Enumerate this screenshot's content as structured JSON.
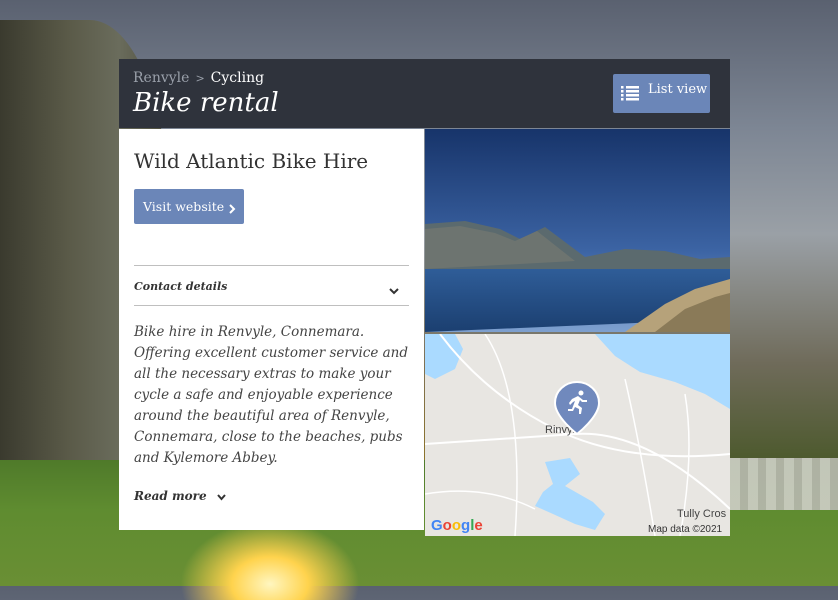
{
  "header": {
    "breadcrumb_parent": "Renvyle",
    "breadcrumb_sep": ">",
    "breadcrumb_current": "Cycling",
    "title": "Bike rental",
    "list_view_label": "List view"
  },
  "listing": {
    "name": "Wild Atlantic Bike Hire",
    "visit_label": "Visit website",
    "contact_label": "Contact details",
    "description": "Bike hire in Renvyle, Connemara. Offering excellent customer service and all the necessary extras to make your cycle a safe and enjoyable experience around the beautiful area of Renvyle, Connemara, close to the beaches, pubs and Kylemore Abbey.",
    "read_more_label": "Read more"
  },
  "map": {
    "town_label": "Rinvyle",
    "tully_label": "Tully Cros",
    "map_data": "Map data ©2021",
    "logo_text": "Google",
    "marker_icon": "running-person-icon"
  },
  "colors": {
    "header_bg": "#2f333c",
    "accent_button": "#6b86b8",
    "map_water": "#aadaff"
  }
}
